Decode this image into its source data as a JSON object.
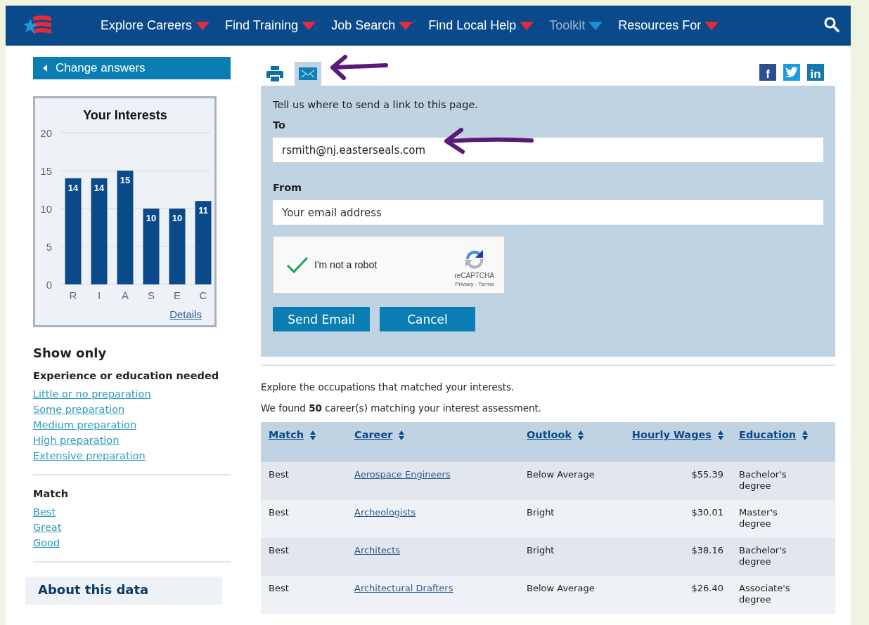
{
  "nav": {
    "items": [
      {
        "label": "Explore Careers",
        "selected": false
      },
      {
        "label": "Find Training",
        "selected": false
      },
      {
        "label": "Job Search",
        "selected": false
      },
      {
        "label": "Find Local Help",
        "selected": false
      },
      {
        "label": "Toolkit",
        "selected": true
      },
      {
        "label": "Resources For",
        "selected": false
      }
    ]
  },
  "sidebar": {
    "change_answers": "Change answers",
    "chart": {
      "chart_data": {
        "type": "bar",
        "title": "Your Interests",
        "categories": [
          "R",
          "I",
          "A",
          "S",
          "E",
          "C"
        ],
        "values": [
          14,
          14,
          15,
          10,
          10,
          11
        ],
        "ylim": [
          0,
          20
        ],
        "yticks": [
          0,
          5,
          10,
          15,
          20
        ],
        "data_labels": true,
        "grid": true
      }
    },
    "details_link": "Details",
    "show_only": "Show only",
    "filter_groups": [
      {
        "heading": "Experience or education needed",
        "links": [
          "Little or no preparation",
          "Some preparation",
          "Medium preparation",
          "High preparation",
          "Extensive preparation"
        ]
      },
      {
        "heading": "Match",
        "links": [
          "Best",
          "Great",
          "Good"
        ]
      }
    ],
    "about": "About this data"
  },
  "share": {
    "tabs": [
      {
        "kind": "print",
        "selected": false
      },
      {
        "kind": "email",
        "selected": true
      }
    ],
    "social": [
      {
        "kind": "facebook",
        "label": "f"
      },
      {
        "kind": "twitter"
      },
      {
        "kind": "linkedin",
        "label": "in"
      }
    ]
  },
  "email_form": {
    "intro": "Tell us where to send a link to this page.",
    "fields": [
      {
        "label": "To",
        "value": "rsmith@nj.easterseals.com"
      },
      {
        "label": "From",
        "placeholder": "Your email address"
      }
    ],
    "captcha": {
      "label": "I'm not a robot",
      "checked": true,
      "brand": "reCAPTCHA",
      "links": "Privacy - Terms"
    },
    "buttons": [
      "Send Email",
      "Cancel"
    ]
  },
  "results": {
    "intro": "Explore the occupations that matched your interests.",
    "count_text": "We found **50** career(s) matching your interest assessment.",
    "table": {
      "columns": [
        "Match",
        "Career",
        "Outlook",
        "Hourly Wages",
        "Education"
      ],
      "rows": [
        {
          "match": "Best",
          "career": "Aerospace Engineers",
          "outlook": "Below Average",
          "wages": "$55.39",
          "education": "Bachelor's degree"
        },
        {
          "match": "Best",
          "career": "Archeologists",
          "outlook": "Bright",
          "wages": "$30.01",
          "education": "Master's degree"
        },
        {
          "match": "Best",
          "career": "Architects",
          "outlook": "Bright",
          "wages": "$38.16",
          "education": "Bachelor's degree"
        },
        {
          "match": "Best",
          "career": "Architectural Drafters",
          "outlook": "Below Average",
          "wages": "$26.40",
          "education": "Associate's degree"
        }
      ]
    }
  }
}
